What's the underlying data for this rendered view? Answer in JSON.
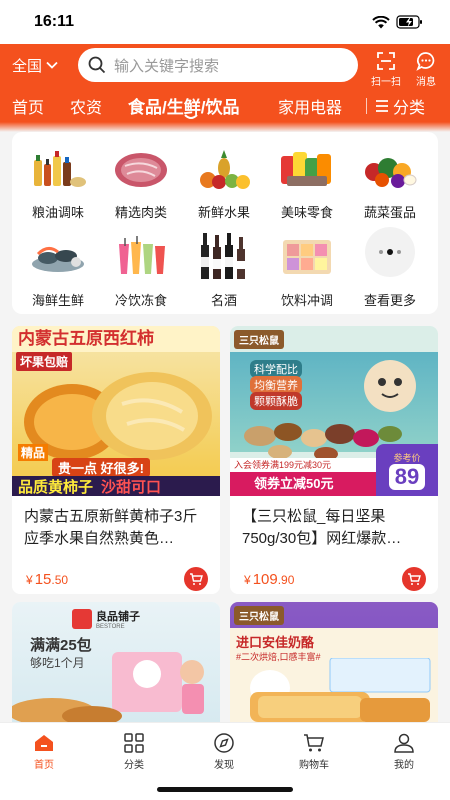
{
  "status": {
    "time": "16:11"
  },
  "header": {
    "region": "全国",
    "search_placeholder": "输入关键字搜索",
    "scan_label": "扫一扫",
    "message_label": "消息",
    "brand_color": "#f4511e"
  },
  "category_tabs": {
    "items": [
      "首页",
      "农资",
      "食品/生鲜/饮品",
      "家用电器"
    ],
    "active": "食品/生鲜/饮品",
    "more_label": "分类"
  },
  "grid": {
    "items": [
      {
        "label": "粮油调味",
        "icon": "grain-oil-icon"
      },
      {
        "label": "精选肉类",
        "icon": "meat-icon"
      },
      {
        "label": "新鲜水果",
        "icon": "fruit-icon"
      },
      {
        "label": "美味零食",
        "icon": "snack-icon"
      },
      {
        "label": "蔬菜蛋品",
        "icon": "vegetable-icon"
      },
      {
        "label": "海鲜生鲜",
        "icon": "seafood-icon"
      },
      {
        "label": "冷饮冻食",
        "icon": "cold-drink-icon"
      },
      {
        "label": "名酒",
        "icon": "wine-icon"
      },
      {
        "label": "饮料冲调",
        "icon": "beverage-icon"
      },
      {
        "label": "查看更多",
        "icon": "more-dots-icon"
      }
    ]
  },
  "products": [
    {
      "title": "内蒙古五原新鲜黄柿子3斤应季水果自然熟黄色…",
      "price_symbol": "¥",
      "price_int": "15",
      "price_dec": ".50",
      "banner_top": "内蒙古五原西红柿",
      "badge": "坏果包赔",
      "tag": "精品",
      "slogan": "贵一点 好很多!",
      "bottom_text_a": "品质黄柿子",
      "bottom_text_b": "沙甜可口"
    },
    {
      "title": "【三只松鼠_每日坚果750g/30包】网红爆款…",
      "price_symbol": "¥",
      "price_int": "109",
      "price_dec": ".90",
      "brand": "三只松鼠",
      "tagline_1": "科学配比",
      "tagline_2": "均衡营养",
      "tagline_3": "颗颗酥脆",
      "promo": "领券立减50元",
      "promo_sub": "入会领券满199元减30元",
      "ref_label": "参考价",
      "ref_price": "89"
    },
    {
      "brand": "良品铺子",
      "brand_en": "BESTORE",
      "headline": "满满25包",
      "sub": "够吃1个月"
    },
    {
      "brand": "三只松鼠",
      "headline": "进口安佳奶酪",
      "sub": "#二次烘焙,口感丰富#"
    }
  ],
  "tabbar": {
    "items": [
      "首页",
      "分类",
      "发现",
      "购物车",
      "我的"
    ],
    "active": "首页"
  }
}
